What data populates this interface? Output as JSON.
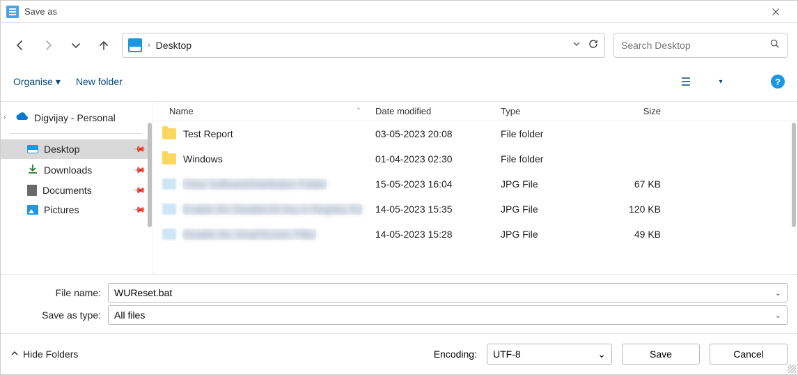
{
  "window": {
    "title": "Save as"
  },
  "breadcrumb": {
    "location": "Desktop"
  },
  "search": {
    "placeholder": "Search Desktop"
  },
  "toolbar": {
    "organise": "Organise",
    "new_folder": "New folder"
  },
  "tree": {
    "cloud": "Digvijay - Personal",
    "desktop": "Desktop",
    "downloads": "Downloads",
    "documents": "Documents",
    "pictures": "Pictures"
  },
  "columns": {
    "name": "Name",
    "date": "Date modified",
    "type": "Type",
    "size": "Size"
  },
  "files": [
    {
      "name": "Test Report",
      "date": "03-05-2023 20:08",
      "type": "File folder",
      "size": "",
      "kind": "folder"
    },
    {
      "name": "Windows",
      "date": "01-04-2023 02:30",
      "type": "File folder",
      "size": "",
      "kind": "folder"
    },
    {
      "name": "Clear SoftwareDistribution Folder",
      "date": "15-05-2023 16:04",
      "type": "JPG File",
      "size": "67 KB",
      "kind": "blurred"
    },
    {
      "name": "Enable the DisableUIA key in Registry Ed",
      "date": "14-05-2023 15:35",
      "type": "JPG File",
      "size": "120 KB",
      "kind": "blurred"
    },
    {
      "name": "Disable the SmartScreen Filter",
      "date": "14-05-2023 15:28",
      "type": "JPG File",
      "size": "49 KB",
      "kind": "blurred"
    }
  ],
  "fields": {
    "filename_label": "File name:",
    "filename_value": "WUReset.bat",
    "savetype_label": "Save as type:",
    "savetype_value": "All files"
  },
  "footer": {
    "hide_folders": "Hide Folders",
    "encoding_label": "Encoding:",
    "encoding_value": "UTF-8",
    "save": "Save",
    "cancel": "Cancel"
  }
}
